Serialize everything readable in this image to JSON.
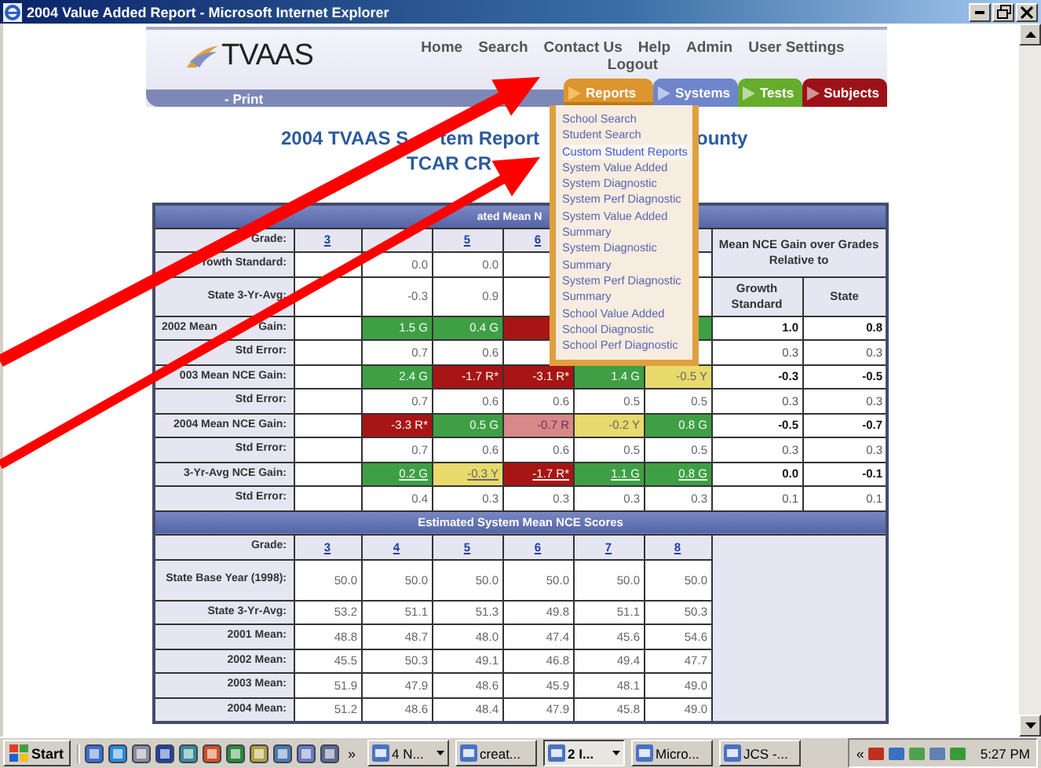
{
  "window": {
    "title": "2004 Value Added Report - Microsoft Internet Explorer"
  },
  "header": {
    "logo": "TVAAS",
    "nav_lines": [
      [
        "Home",
        "Search",
        "Contact Us",
        "Help",
        "Admin",
        "User Settings"
      ],
      [
        "Logout"
      ]
    ],
    "print_link": "- Print",
    "tabs": [
      {
        "label": "Reports",
        "selected": true,
        "color": "#dd9530"
      },
      {
        "label": "Systems",
        "selected": false,
        "color": "#6f86cc"
      },
      {
        "label": "Tests",
        "selected": false,
        "color": "#66ad2c"
      },
      {
        "label": "Subjects",
        "selected": false,
        "color": "#9c1218"
      }
    ]
  },
  "menu": {
    "items": [
      {
        "label": "School Search",
        "selected": false
      },
      {
        "label": "Student Search",
        "selected": false
      },
      {
        "label": "Custom Student Reports",
        "selected": true
      },
      {
        "label": "System Value Added",
        "selected": false
      },
      {
        "label": "System Diagnostic",
        "selected": false
      },
      {
        "label": "System Perf Diagnostic",
        "selected": false
      },
      {
        "label": "System Value Added Summary",
        "selected": false
      },
      {
        "label": "System Diagnostic Summary",
        "selected": false
      },
      {
        "label": "System Perf Diagnostic Summary",
        "selected": false
      },
      {
        "label": "School Value Added",
        "selected": false
      },
      {
        "label": "School Diagnostic",
        "selected": false
      },
      {
        "label": "School Perf Diagnostic",
        "selected": false
      }
    ]
  },
  "report_title": {
    "line_1": [
      "2004 TVAAS S",
      "tem Report",
      "ounty"
    ],
    "line_2": "TCAR CR"
  },
  "top_table": {
    "band": "ated Mean N",
    "grade_label": "Grade:",
    "grades": [
      {
        "kind": "link",
        "text": "3"
      },
      {
        "kind": "blank"
      },
      {
        "kind": "link",
        "text": "5"
      },
      {
        "kind": "link",
        "text": "6"
      },
      {
        "kind": "blank"
      },
      {
        "kind": "blank"
      }
    ],
    "summary_header": "Mean NCE Gain over Grades Relative to",
    "summary_columns": [
      "Growth Standard",
      "State"
    ],
    "rows": [
      {
        "label": [
          "rowth Standard:"
        ],
        "cells": [
          {
            "kind": "blank"
          },
          {
            "kind": "value",
            "text": "0.0"
          },
          {
            "kind": "value",
            "text": "0.0"
          },
          {
            "kind": "blank"
          },
          {
            "kind": "blank"
          },
          {
            "kind": "blank"
          }
        ]
      },
      {
        "label": [
          "State 3-Yr-Avg:"
        ],
        "cells": [
          {
            "kind": "blank"
          },
          {
            "kind": "value",
            "text": "-0.3"
          },
          {
            "kind": "value",
            "text": "0.9"
          },
          {
            "kind": "blank"
          },
          {
            "kind": "blank"
          },
          {
            "kind": "blank"
          }
        ]
      },
      {
        "kind": "gain",
        "label": [
          "2002 Mean",
          "Gain:"
        ],
        "cells": [
          {
            "kind": "blank"
          },
          {
            "kind": "flag",
            "text": "1.5 G",
            "color": "#3f9f45"
          },
          {
            "kind": "flag",
            "text": "0.4 G",
            "color": "#3f9f45"
          },
          {
            "kind": "flag",
            "color": "#a81515"
          },
          {
            "kind": "blank"
          },
          {
            "kind": "flag",
            "color": "#3f9f45"
          }
        ],
        "summary": [
          "1.0",
          "0.8"
        ]
      },
      {
        "kind": "plain",
        "label": [
          "Std Error:"
        ],
        "cells": [
          {
            "kind": "blank"
          },
          {
            "kind": "value",
            "text": "0.7"
          },
          {
            "kind": "value",
            "text": "0.6"
          },
          {
            "kind": "blank"
          },
          {
            "kind": "blank"
          },
          {
            "kind": "blank"
          }
        ],
        "summary": [
          "0.3",
          "0.3"
        ]
      },
      {
        "kind": "gain",
        "label": [
          "003 Mean NCE Gain:"
        ],
        "cells": [
          {
            "kind": "blank"
          },
          {
            "kind": "flag",
            "text": "2.4 G",
            "color": "#3f9f45"
          },
          {
            "kind": "flag",
            "text": "-1.7 R*",
            "color": "#a81515"
          },
          {
            "kind": "flag",
            "text": "-3.1 R*",
            "color": "#a81515"
          },
          {
            "kind": "flag",
            "text": "1.4 G",
            "color": "#3f9f45"
          },
          {
            "kind": "flag",
            "text": "-0.5 Y",
            "color": "#e8da6c"
          }
        ],
        "summary": [
          "-0.3",
          "-0.5"
        ]
      },
      {
        "kind": "plain",
        "label": [
          "Std Error:"
        ],
        "cells": [
          {
            "kind": "blank"
          },
          {
            "kind": "value",
            "text": "0.7"
          },
          {
            "kind": "value",
            "text": "0.6"
          },
          {
            "kind": "value",
            "text": "0.6"
          },
          {
            "kind": "value",
            "text": "0.5"
          },
          {
            "kind": "value",
            "text": "0.5"
          }
        ],
        "summary": [
          "0.3",
          "0.3"
        ]
      },
      {
        "kind": "gain",
        "label": [
          "2004 Mean NCE Gain:"
        ],
        "cells": [
          {
            "kind": "blank"
          },
          {
            "kind": "flag",
            "text": "-3.3 R*",
            "color": "#a81515"
          },
          {
            "kind": "flag",
            "text": "0.5 G",
            "color": "#3f9f45"
          },
          {
            "kind": "flag",
            "text": "-0.7 R",
            "color": "#d88888"
          },
          {
            "kind": "flag",
            "text": "-0.2 Y",
            "color": "#e8da6c"
          },
          {
            "kind": "flag",
            "text": "0.8 G",
            "color": "#3f9f45"
          }
        ],
        "summary": [
          "-0.5",
          "-0.7"
        ]
      },
      {
        "kind": "plain",
        "label": [
          "Std Error:"
        ],
        "cells": [
          {
            "kind": "blank"
          },
          {
            "kind": "value",
            "text": "0.7"
          },
          {
            "kind": "value",
            "text": "0.6"
          },
          {
            "kind": "value",
            "text": "0.6"
          },
          {
            "kind": "value",
            "text": "0.5"
          },
          {
            "kind": "value",
            "text": "0.5"
          }
        ],
        "summary": [
          "0.3",
          "0.3"
        ]
      },
      {
        "kind": "gain",
        "label": [
          "3-Yr-Avg NCE Gain:"
        ],
        "cells": [
          {
            "kind": "blank"
          },
          {
            "kind": "flag",
            "text": "0.2 G",
            "color": "#3f9f45",
            "link": true
          },
          {
            "kind": "flag",
            "text": "-0.3 Y",
            "color": "#e8da6c",
            "link": true
          },
          {
            "kind": "flag",
            "text": "-1.7 R*",
            "color": "#a81515",
            "link": true
          },
          {
            "kind": "flag",
            "text": "1.1 G",
            "color": "#3f9f45",
            "link": true
          },
          {
            "kind": "flag",
            "text": "0.8 G",
            "color": "#3f9f45",
            "link": true
          }
        ],
        "summary": [
          "0.0",
          "-0.1"
        ]
      },
      {
        "kind": "plain",
        "label": [
          "Std Error:"
        ],
        "cells": [
          {
            "kind": "blank"
          },
          {
            "kind": "value",
            "text": "0.4"
          },
          {
            "kind": "value",
            "text": "0.3"
          },
          {
            "kind": "value",
            "text": "0.3"
          },
          {
            "kind": "value",
            "text": "0.3"
          },
          {
            "kind": "value",
            "text": "0.3"
          }
        ],
        "summary": [
          "0.1",
          "0.1"
        ]
      }
    ]
  },
  "bottom_table": {
    "band": "Estimated System Mean NCE Scores",
    "grade_label": "Grade:",
    "grades": [
      "3",
      "4",
      "5",
      "6",
      "7",
      "8"
    ],
    "rows": [
      {
        "label": "State Base Year (1998):",
        "cells": [
          "50.0",
          "50.0",
          "50.0",
          "50.0",
          "50.0",
          "50.0"
        ]
      },
      {
        "label": "State 3-Yr-Avg:",
        "cells": [
          "53.2",
          "51.1",
          "51.3",
          "49.8",
          "51.1",
          "50.3"
        ]
      },
      {
        "label": "2001 Mean:",
        "cells": [
          "48.8",
          "48.7",
          "48.0",
          "47.4",
          "45.6",
          "54.6"
        ]
      },
      {
        "label": "2002 Mean:",
        "cells": [
          "45.5",
          "50.3",
          "49.1",
          "46.8",
          "49.4",
          "47.7"
        ]
      },
      {
        "label": "2003 Mean:",
        "cells": [
          "51.9",
          "47.9",
          "48.6",
          "45.9",
          "48.1",
          "49.0"
        ]
      },
      {
        "label": "2004 Mean:",
        "cells": [
          "51.2",
          "48.6",
          "48.4",
          "47.9",
          "45.8",
          "49.0"
        ]
      }
    ]
  },
  "taskbar": {
    "start": "Start",
    "quick_more": "»",
    "tasks": [
      {
        "label": "4 N...",
        "dropdown": true,
        "selected": false
      },
      {
        "label": "creat...",
        "dropdown": false,
        "selected": false
      },
      {
        "label": "2 I...",
        "dropdown": true,
        "selected": true
      },
      {
        "label": "Micro...",
        "dropdown": false,
        "selected": false
      },
      {
        "label": "JCS -...",
        "dropdown": false,
        "selected": false
      }
    ],
    "tray_more": "«",
    "clock": "5:27 PM"
  }
}
